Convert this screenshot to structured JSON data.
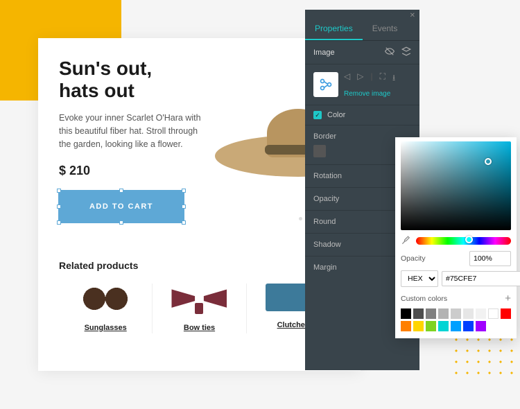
{
  "product": {
    "title": "Sun's out,\nhats out",
    "description": "Evoke your inner Scarlet O'Hara with this beautiful fiber hat. Stroll through the garden, looking like a flower.",
    "price": "$ 210",
    "cta": "ADD TO CART"
  },
  "related": {
    "title": "Related products",
    "items": [
      {
        "label": "Sunglasses"
      },
      {
        "label": "Bow ties"
      },
      {
        "label": "Clutches"
      }
    ]
  },
  "panel": {
    "tabs": {
      "properties": "Properties",
      "events": "Events"
    },
    "image_label": "Image",
    "remove_image": "Remove image",
    "color_label": "Color",
    "border_label": "Border",
    "rotation_label": "Rotation",
    "opacity_label": "Opacity",
    "round_label": "Round",
    "shadow_label": "Shadow",
    "margin_label": "Margin"
  },
  "picker": {
    "opacity_label": "Opacity",
    "opacity_value": "100%",
    "format": "HEX",
    "hex_value": "#75CFE7",
    "custom_label": "Custom colors",
    "swatches": [
      "#000000",
      "#4d4d4d",
      "#808080",
      "#b3b3b3",
      "#cccccc",
      "#e6e6e6",
      "#f2f2f2",
      "#ffffff",
      "#ff0000",
      "#ff8000",
      "#ffd500",
      "#7ed321",
      "#00d4d4",
      "#00a0ff",
      "#0040ff",
      "#a000ff"
    ]
  }
}
